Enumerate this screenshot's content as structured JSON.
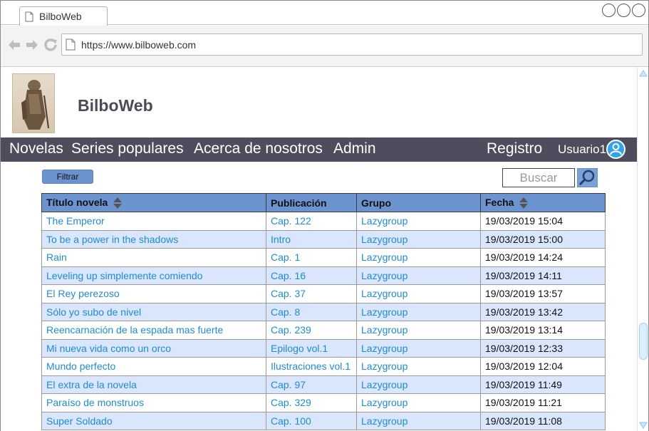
{
  "browser": {
    "tab_title": "BilboWeb",
    "url": "https://www.bilboweb.com"
  },
  "site": {
    "title": "BilboWeb"
  },
  "menu": {
    "novelas": "Novelas",
    "series": "Series populares",
    "about": "Acerca de nosotros",
    "admin": "Admin",
    "registro": "Registro",
    "user": "Usuario1"
  },
  "toolbar": {
    "filter_label": "Filtrar",
    "search_placeholder": "Buscar"
  },
  "table": {
    "headers": [
      "Título novela",
      "Publicación",
      "Grupo",
      "Fecha"
    ],
    "rows": [
      [
        "The Emperor",
        "Cap. 122",
        "Lazygroup",
        "19/03/2019 15:04"
      ],
      [
        "To be a power in the shadows",
        "Intro",
        "Lazygroup",
        "19/03/2019 15:00"
      ],
      [
        "Rain",
        "Cap. 1",
        "Lazygroup",
        "19/03/2019 14:24"
      ],
      [
        "Leveling up simplemente comiendo",
        "Cap. 16",
        "Lazygroup",
        "19/03/2019 14:11"
      ],
      [
        "El Rey perezoso",
        "Cap. 37",
        "Lazygroup",
        "19/03/2019 13:57"
      ],
      [
        "Sólo yo subo de nivel",
        "Cap. 8",
        "Lazygroup",
        "19/03/2019 13:42"
      ],
      [
        "Reencarnación de la espada mas fuerte",
        "Cap. 239",
        "Lazygroup",
        "19/03/2019 13:14"
      ],
      [
        "Mi nueva vida como un orco",
        "Epilogo vol.1",
        "Lazygroup",
        "19/03/2019 12:33"
      ],
      [
        "Mundo perfecto",
        "Ilustraciones vol.1",
        "Lazygroup",
        "19/03/2019 12:04"
      ],
      [
        "El extra de la novela",
        "Cap. 97",
        "Lazygroup",
        "19/03/2019 11:49"
      ],
      [
        "Paraíso de monstruos",
        "Cap. 329",
        "Lazygroup",
        "19/03/2019 11:21"
      ],
      [
        "Super Soldado",
        "Cap. 100",
        "Lazygroup",
        "19/03/2019 11:08"
      ]
    ]
  },
  "colors": {
    "menubar": "#4d4d5e",
    "header_row": "#6b93cf",
    "alt_row": "#d9e6fb",
    "link": "#1e8be0"
  }
}
